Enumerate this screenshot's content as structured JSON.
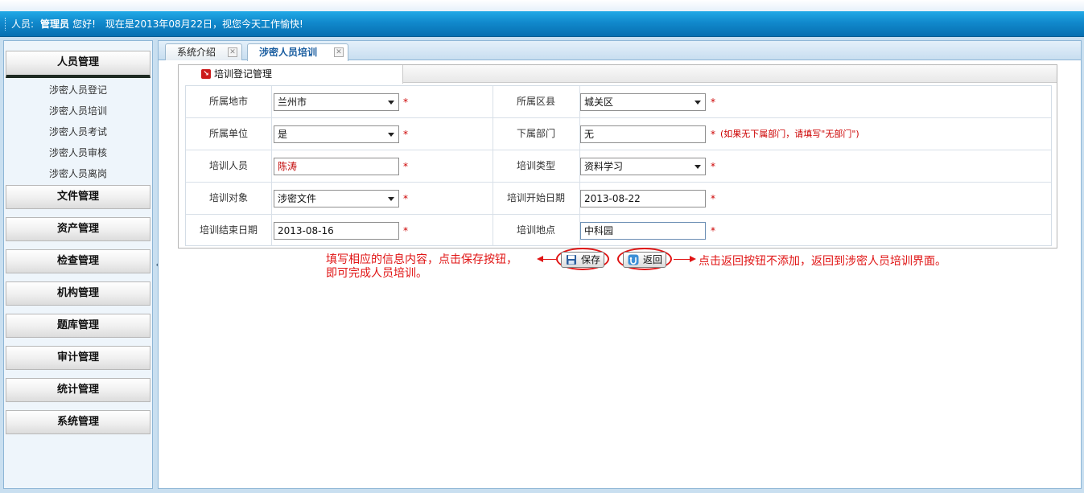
{
  "header": {
    "user_label": "人员:",
    "user_name": "管理员",
    "greeting": "您好!",
    "date_text": "现在是2013年08月22日，视您今天工作愉快!"
  },
  "sidebar": {
    "menus": [
      {
        "label": "人员管理",
        "active": true
      },
      {
        "label": "文件管理"
      },
      {
        "label": "资产管理"
      },
      {
        "label": "检查管理"
      },
      {
        "label": "机构管理"
      },
      {
        "label": "题库管理"
      },
      {
        "label": "审计管理"
      },
      {
        "label": "统计管理"
      },
      {
        "label": "系统管理"
      }
    ],
    "sub_items": [
      "涉密人员登记",
      "涉密人员培训",
      "涉密人员考试",
      "涉密人员审核",
      "涉密人员离岗"
    ],
    "collapse_icon": "double-chevron-left-icon"
  },
  "tabs": [
    {
      "label": "系统介绍",
      "active": false
    },
    {
      "label": "涉密人员培训",
      "active": true
    }
  ],
  "form": {
    "section_title": "培训登记管理",
    "required_mark": "*",
    "fields": {
      "city": {
        "label": "所属地市",
        "value": "兰州市"
      },
      "district": {
        "label": "所属区县",
        "value": "城关区"
      },
      "unit": {
        "label": "所属单位",
        "value": "是"
      },
      "department": {
        "label": "下属部门",
        "value": "无",
        "hint": "(如果无下属部门，请填写\"无部门\")"
      },
      "trainee": {
        "label": "培训人员",
        "value": "陈涛"
      },
      "train_type": {
        "label": "培训类型",
        "value": "资料学习"
      },
      "train_target": {
        "label": "培训对象",
        "value": "涉密文件"
      },
      "start_date": {
        "label": "培训开始日期",
        "value": "2013-08-22"
      },
      "end_date": {
        "label": "培训结束日期",
        "value": "2013-08-16"
      },
      "location": {
        "label": "培训地点",
        "value": "中科园"
      }
    }
  },
  "actions": {
    "save_label": "保存",
    "back_label": "返回"
  },
  "annotations": {
    "left_line1": "填写相应的信息内容，点击保存按钮，",
    "left_line2": "即可完成人员培训。",
    "right": "点击返回按钮不添加，返回到涉密人员培训界面。"
  },
  "colors": {
    "header_blue": "#1189cc",
    "annotation_red": "#e01414",
    "required_red": "#cc0000"
  }
}
